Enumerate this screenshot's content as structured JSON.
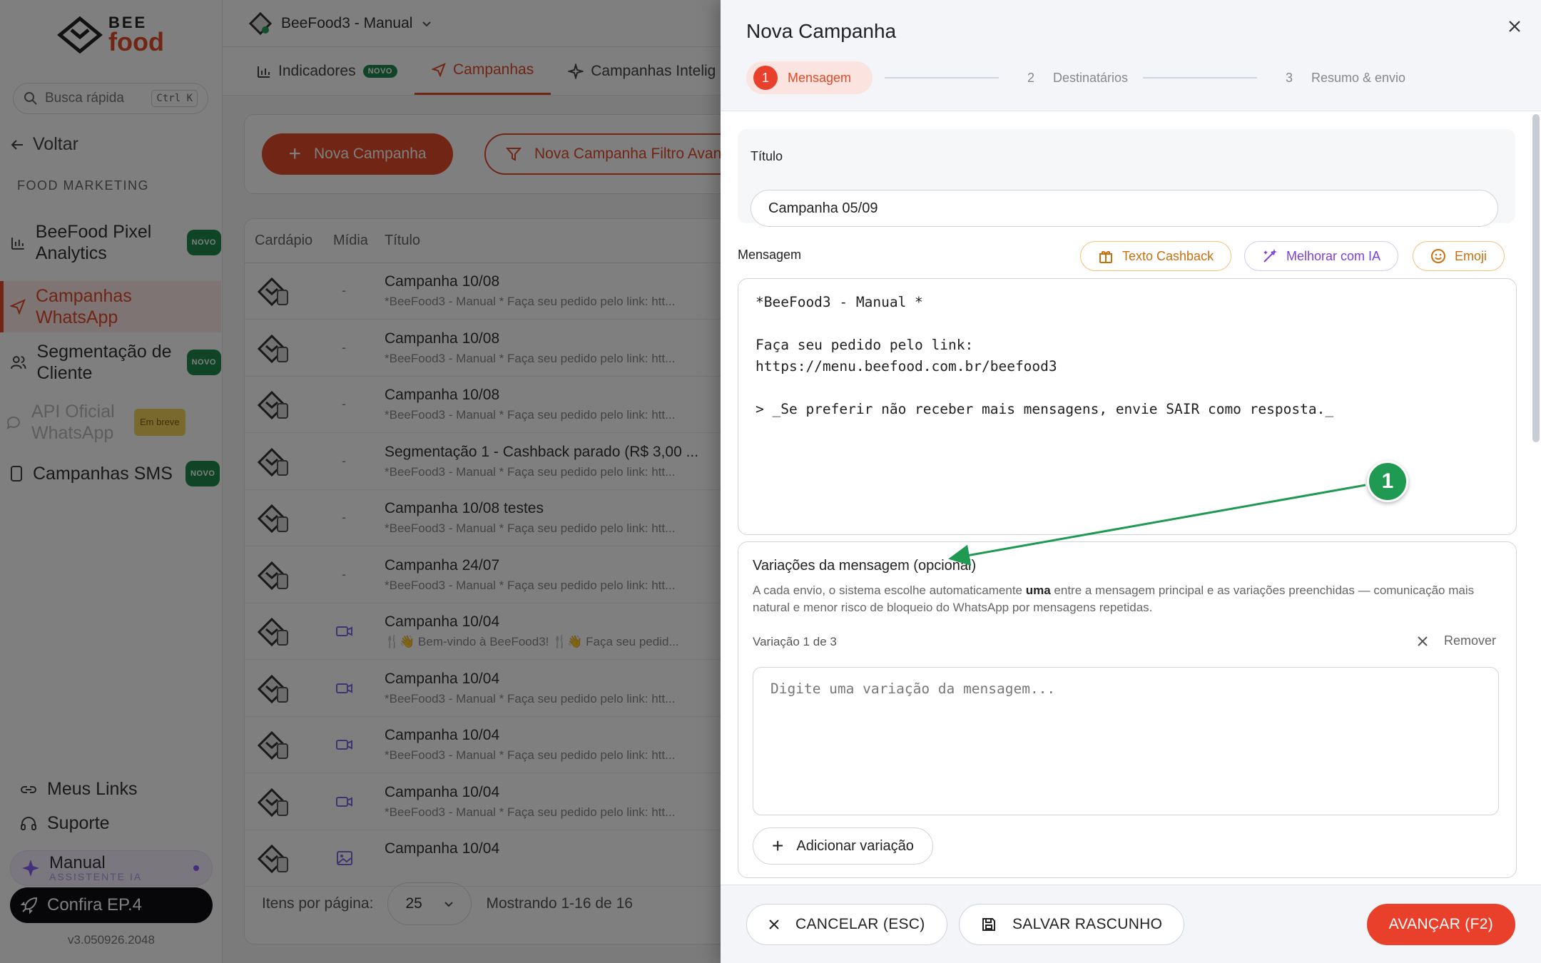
{
  "sidebar": {
    "logo_top": "BEE",
    "logo_bottom": "food",
    "search_placeholder": "Busca rápida",
    "search_shortcut": "Ctrl K",
    "back_label": "Voltar",
    "section_label": "FOOD MARKETING",
    "items": [
      {
        "label": "BeeFood Pixel Analytics",
        "badge": "NOVO"
      },
      {
        "label": "Campanhas WhatsApp",
        "badge": ""
      },
      {
        "label": "Segmentação de Cliente",
        "badge": "NOVO"
      },
      {
        "label": "API Oficial WhatsApp",
        "badge": "Em breve"
      },
      {
        "label": "Campanhas SMS",
        "badge": "NOVO"
      }
    ],
    "my_links": "Meus Links",
    "support": "Suporte",
    "assistant_name": "Manual",
    "assistant_sub": "ASSISTENTE IA",
    "episode": "Confira EP.4",
    "version": "v3.050926.2048"
  },
  "topbar": {
    "store_name": "BeeFood3 - Manual"
  },
  "tabs": [
    {
      "label": "Indicadores",
      "badge": "NOVO"
    },
    {
      "label": "Campanhas",
      "badge": ""
    },
    {
      "label": "Campanhas Intelig",
      "badge": ""
    }
  ],
  "actions": {
    "new_campaign": "Nova Campanha",
    "new_filter_campaign": "Nova Campanha Filtro Avançado"
  },
  "table": {
    "headers": [
      "Cardápio",
      "Mídia",
      "Título"
    ],
    "rows": [
      {
        "title": "Campanha 10/08",
        "subtitle": "*BeeFood3 - Manual * Faça seu pedido pelo link: htt...",
        "media": "-"
      },
      {
        "title": "Campanha 10/08",
        "subtitle": "*BeeFood3 - Manual * Faça seu pedido pelo link: htt...",
        "media": "-"
      },
      {
        "title": "Campanha 10/08",
        "subtitle": "*BeeFood3 - Manual * Faça seu pedido pelo link: htt...",
        "media": "-"
      },
      {
        "title": "Segmentação 1 - Cashback parado (R$ 3,00 ...",
        "subtitle": "*BeeFood3 - Manual * Faça seu pedido pelo link: htt...",
        "media": "-"
      },
      {
        "title": "Campanha 10/08 testes",
        "subtitle": "*BeeFood3 - Manual * Faça seu pedido pelo link: htt...",
        "media": "-"
      },
      {
        "title": "Campanha 24/07",
        "subtitle": "*BeeFood3 - Manual * Faça seu pedido pelo link: htt...",
        "media": "-"
      },
      {
        "title": "Campanha 10/04",
        "subtitle": "🍴👋 Bem-vindo à BeeFood3! 🍴👋 Faça seu pedid...",
        "media": "video"
      },
      {
        "title": "Campanha 10/04",
        "subtitle": "*BeeFood3 - Manual * Faça seu pedido pelo link: htt...",
        "media": "video"
      },
      {
        "title": "Campanha 10/04",
        "subtitle": "*BeeFood3 - Manual * Faça seu pedido pelo link: htt...",
        "media": "video"
      },
      {
        "title": "Campanha 10/04",
        "subtitle": "*BeeFood3 - Manual * Faça seu pedido pelo link: htt...",
        "media": "video"
      },
      {
        "title": "Campanha 10/04",
        "subtitle": "",
        "media": "image"
      }
    ],
    "per_page_label": "Itens por página:",
    "per_page_value": "25",
    "showing": "Mostrando 1-16 de 16"
  },
  "drawer": {
    "title": "Nova Campanha",
    "steps": [
      {
        "num": "1",
        "label": "Mensagem"
      },
      {
        "num": "2",
        "label": "Destinatários"
      },
      {
        "num": "3",
        "label": "Resumo & envio"
      }
    ],
    "title_label": "Título",
    "title_value": "Campanha 05/09",
    "message_label": "Mensagem",
    "btn_cashback": "Texto Cashback",
    "btn_ai": "Melhorar com IA",
    "btn_emoji": "Emoji",
    "message_value": "*BeeFood3 - Manual *\n\nFaça seu pedido pelo link:\nhttps://menu.beefood.com.br/beefood3\n\n> _Se preferir não receber mais mensagens, envie SAIR como resposta._",
    "variations_title": "Variações da mensagem (opcional)",
    "variations_desc_1": "A cada envio, o sistema escolhe automaticamente ",
    "variations_desc_bold": "uma",
    "variations_desc_2": " entre a mensagem principal e as variações preenchidas — comunicação mais natural e menor risco de bloqueio do WhatsApp por mensagens repetidas.",
    "variation_count": "Variação 1 de 3",
    "remove_label": "Remover",
    "variation_placeholder": "Digite uma variação da mensagem...",
    "add_variation": "Adicionar variação",
    "cancel": "CANCELAR (ESC)",
    "save_draft": "SALVAR RASCUNHO",
    "next": "AVANÇAR (F2)"
  },
  "annotation": {
    "badge": "1",
    "color": "#1f9a52"
  },
  "colors": {
    "brand": "#e14a2a",
    "primary_btn": "#e8402a",
    "ai_purple": "#7b3fe0",
    "cashback_orange": "#c7700d"
  }
}
